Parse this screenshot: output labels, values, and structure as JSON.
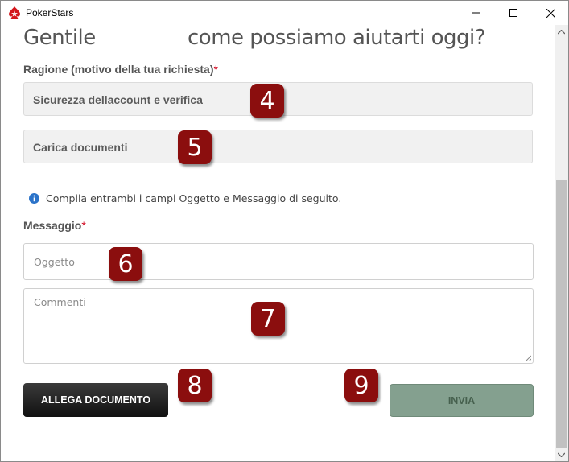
{
  "window": {
    "title": "PokerStars",
    "icon": "pokerstars-spade-icon",
    "controls": [
      "minimize-icon",
      "maximize-icon",
      "close-icon"
    ]
  },
  "heading": {
    "part1": "Gentile",
    "part2": "come possiamo aiutarti oggi?"
  },
  "reason": {
    "label": "Ragione (motivo della tua richiesta)",
    "required_mark": "*",
    "field1_value": "Sicurezza dellaccount e verifica",
    "field2_value": "Carica documenti"
  },
  "info": {
    "icon": "info-icon",
    "text": "Compila entrambi i campi Oggetto e Messaggio di seguito."
  },
  "message": {
    "label": "Messaggio",
    "required_mark": "*",
    "subject_placeholder": "Oggetto",
    "comments_placeholder": "Commenti"
  },
  "buttons": {
    "attach_label": "ALLEGA DOCUMENTO",
    "send_label": "INVIA"
  },
  "callouts": {
    "c4": "4",
    "c5": "5",
    "c6": "6",
    "c7": "7",
    "c8": "8",
    "c9": "9"
  },
  "colors": {
    "callout": "#8b0e0e",
    "required": "#d0021b",
    "send_button": "#84a08f",
    "attach_button": "#1e1e1e",
    "info_icon": "#2b73c9"
  }
}
